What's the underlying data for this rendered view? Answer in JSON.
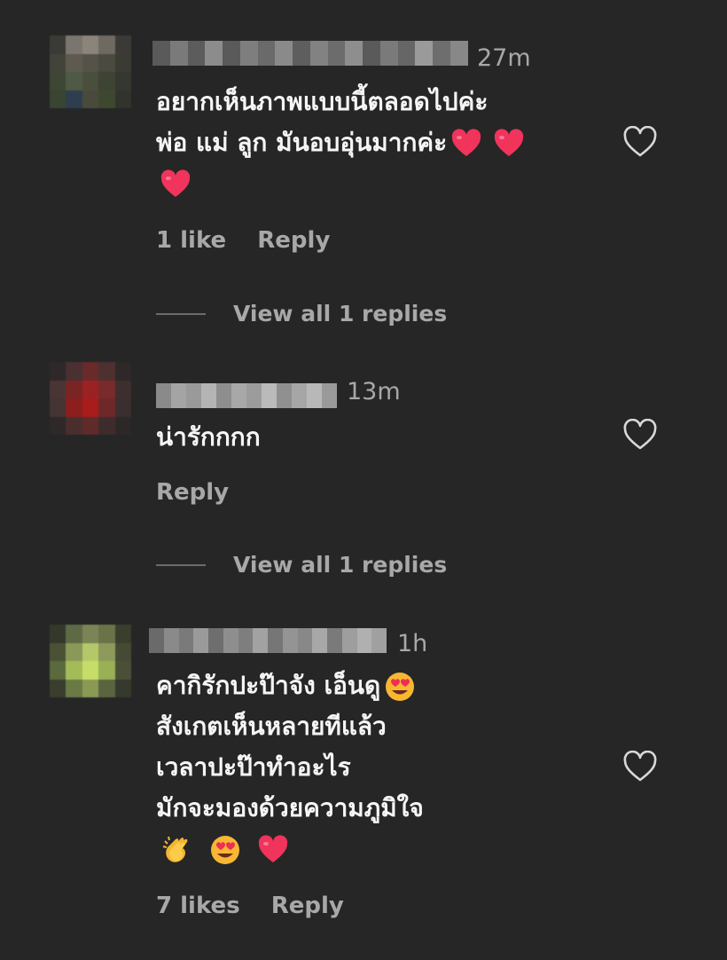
{
  "comments": [
    {
      "time": "27m",
      "lines": [
        "อยากเห็นภาพแบบนี้ตลอดไปค่ะ",
        "พ่อ แม่ ลูก มันอบอุ่นมากค่ะ"
      ],
      "likes": "1 like",
      "reply": "Reply",
      "view_replies": "View all 1 replies",
      "avatar_colors": [
        "#3a3a36",
        "#7a766e",
        "#8a847a",
        "#6e6a62",
        "#3c3a36",
        "#42443a",
        "#5e5a50",
        "#55524a",
        "#4a4a40",
        "#3a3c34",
        "#3e4634",
        "#4e5a44",
        "#4a4e3c",
        "#3e4432",
        "#343830",
        "#3a4432",
        "#2e3e4e",
        "#4a4a3c",
        "#3e4830",
        "#30342c"
      ],
      "name_blur": [
        "#5a5a5a",
        "#7a7a7a",
        "#5c5c5c",
        "#8c8c8c",
        "#5a5a5a",
        "#7e7e7e",
        "#6a6a6a",
        "#8a8a8a",
        "#5e5e5e",
        "#828282",
        "#6c6c6c",
        "#8e8e8e",
        "#5a5a5a",
        "#7a7a7a",
        "#666666",
        "#9a9a9a",
        "#6e6e6e",
        "#888888"
      ]
    },
    {
      "time": "13m",
      "lines": [
        "น่ารักกกก"
      ],
      "reply": "Reply",
      "view_replies": "View all 1 replies",
      "avatar_colors": [
        "#2e2828",
        "#4a3030",
        "#6a2a2a",
        "#4e3030",
        "#2e2828",
        "#4a3434",
        "#7a2424",
        "#9a2222",
        "#7a2a2a",
        "#3e2e2e",
        "#443434",
        "#8c1e1e",
        "#a81c1c",
        "#6e2828",
        "#3a2e2e",
        "#2e2828",
        "#4a2e2e",
        "#5e2a2a",
        "#3e2c2c",
        "#2c2828"
      ],
      "name_blur": [
        "#8a8a8a",
        "#a4a4a4",
        "#9a9a9a",
        "#b4b4b4",
        "#8e8e8e",
        "#a8a8a8",
        "#9c9c9c",
        "#bababa",
        "#909090",
        "#a6a6a6",
        "#b8b8b8",
        "#9a9a9a"
      ]
    },
    {
      "time": "1h",
      "lines": [
        "คากิรักปะป๊าจัง เอ็นดู",
        "สังเกตเห็นหลายทีแล้ว",
        "เวลาปะป๊าทำอะไร",
        "มักจะมองด้วยความภูมิใจ"
      ],
      "likes": "7 likes",
      "reply": "Reply",
      "avatar_colors": [
        "#34382a",
        "#5e6a44",
        "#7a8456",
        "#6a7248",
        "#3a3e2c",
        "#4a5236",
        "#8a9858",
        "#b4c86a",
        "#8e9a5c",
        "#444a34",
        "#5a6a3c",
        "#a4bc58",
        "#c8dc6a",
        "#9ab054",
        "#4a5038",
        "#3a3e2e",
        "#6a7a44",
        "#8a9a54",
        "#5a6440",
        "#363a2c"
      ],
      "name_blur": [
        "#6a6a6a",
        "#8a8a8a",
        "#7a7a7a",
        "#9a9a9a",
        "#6e6e6e",
        "#8e8e8e",
        "#7e7e7e",
        "#a2a2a2",
        "#767676",
        "#949494",
        "#888888",
        "#a8a8a8",
        "#7a7a7a",
        "#9e9e9e",
        "#b0b0b0",
        "#a0a0a0"
      ]
    }
  ]
}
